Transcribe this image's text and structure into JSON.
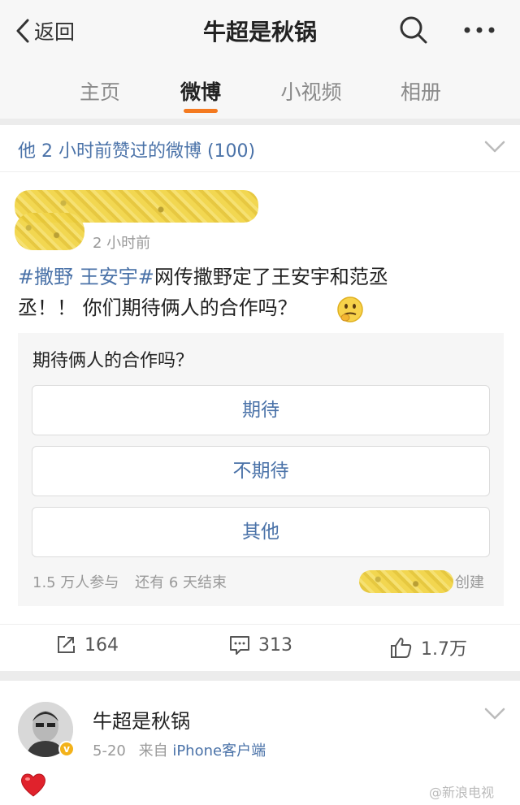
{
  "header": {
    "back_label": "返回",
    "title": "牛超是秋锅"
  },
  "tabs": [
    {
      "label": "主页",
      "active": false
    },
    {
      "label": "微博",
      "active": true
    },
    {
      "label": "小视频",
      "active": false
    },
    {
      "label": "相册",
      "active": false
    }
  ],
  "liked_bar": {
    "text": "他 2 小时前赞过的微博 (100)"
  },
  "post": {
    "time": "2 小时前",
    "topic": "#撒野 王安宇#",
    "text_line1": "网传撒野定了王安宇和范丞",
    "text_line2": "丞！！ 你们期待俩人的合作吗？",
    "poll": {
      "question": "期待俩人的合作吗？",
      "options": [
        "期待",
        "不期待",
        "其他"
      ],
      "participants": "1.5 万人参与",
      "remaining": "还有 6 天结束",
      "creator_suffix": "创建"
    },
    "actions": {
      "repost_count": "164",
      "comment_count": "313",
      "like_count": "1.7万"
    }
  },
  "second_post": {
    "username": "牛超是秋锅",
    "date": "5-20",
    "source_prefix": "来自",
    "source": "iPhone客户端",
    "verified_badge": "v"
  },
  "watermark": "@新浪电视",
  "colors": {
    "link_blue": "#4a72a8",
    "accent_orange": "#f47a20",
    "header_bg": "#f7f7f7",
    "verified_gold": "#f3b21a",
    "heart_red": "#e0222c"
  }
}
